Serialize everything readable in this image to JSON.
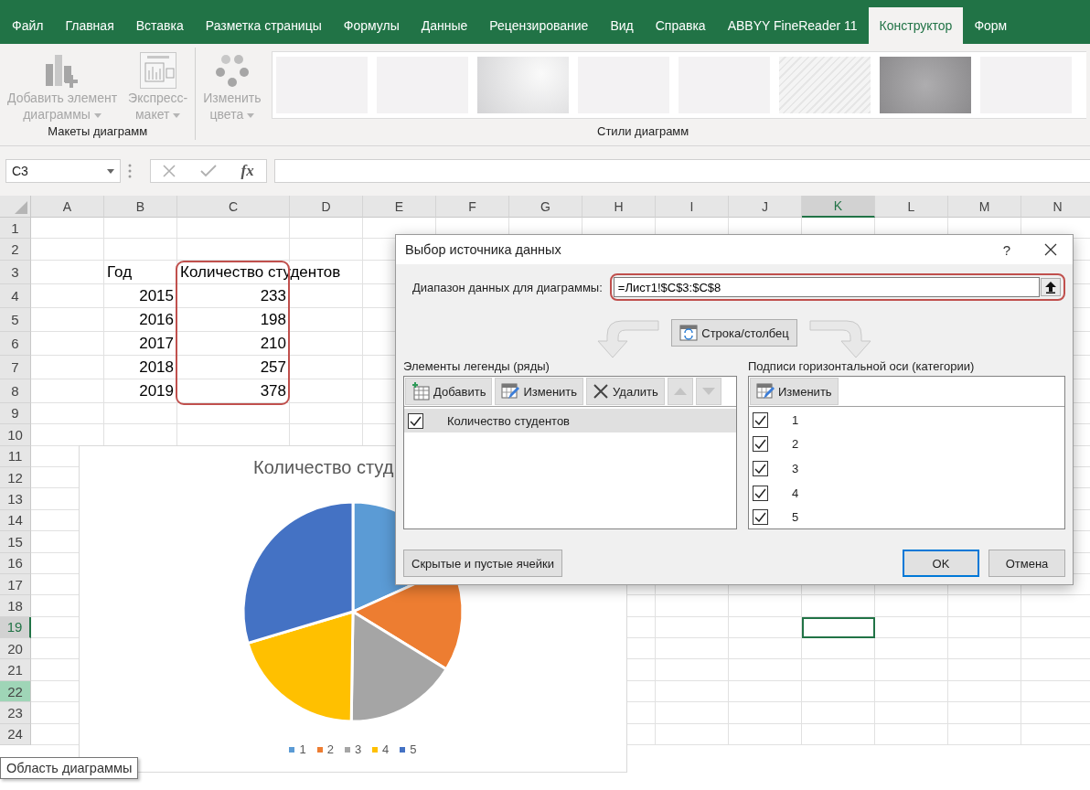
{
  "ribbon_tabs": [
    {
      "label": "Файл",
      "selected": false
    },
    {
      "label": "Главная",
      "selected": false
    },
    {
      "label": "Вставка",
      "selected": false
    },
    {
      "label": "Разметка страницы",
      "selected": false
    },
    {
      "label": "Формулы",
      "selected": false
    },
    {
      "label": "Данные",
      "selected": false
    },
    {
      "label": "Рецензирование",
      "selected": false
    },
    {
      "label": "Вид",
      "selected": false
    },
    {
      "label": "Справка",
      "selected": false
    },
    {
      "label": "ABBYY FineReader 11",
      "selected": false
    },
    {
      "label": "Конструктор",
      "selected": true
    },
    {
      "label": "Форм",
      "selected": false
    }
  ],
  "ribbon_groups": [
    {
      "label": "Макеты диаграмм",
      "buttons": [
        {
          "label": "Добавить элемент\nдиаграммы",
          "kind": "add-element",
          "disabled": true
        },
        {
          "label": "Экспресс-\nмакет",
          "kind": "quick-layout",
          "disabled": true
        }
      ]
    },
    {
      "label": "Стили диаграмм",
      "buttons": [
        {
          "label": "Изменить\nцвета",
          "kind": "colors",
          "disabled": true
        }
      ],
      "styles": [
        {
          "kind": "plain"
        },
        {
          "kind": "plain"
        },
        {
          "kind": "gradient"
        },
        {
          "kind": "plain"
        },
        {
          "kind": "plain"
        },
        {
          "kind": "hatched"
        },
        {
          "kind": "dark"
        },
        {
          "kind": "plain"
        }
      ]
    }
  ],
  "formula_bar": {
    "name_box": "C3",
    "function_label": "fx"
  },
  "sheet": {
    "columns": [
      {
        "label": "A",
        "selected": false
      },
      {
        "label": "B",
        "selected": false
      },
      {
        "label": "C",
        "selected": false
      },
      {
        "label": "D",
        "selected": false
      },
      {
        "label": "E",
        "selected": false
      },
      {
        "label": "F",
        "selected": false
      },
      {
        "label": "G",
        "selected": false
      },
      {
        "label": "H",
        "selected": false
      },
      {
        "label": "I",
        "selected": false
      },
      {
        "label": "J",
        "selected": false
      },
      {
        "label": "K",
        "selected": true
      },
      {
        "label": "L",
        "selected": false
      },
      {
        "label": "M",
        "selected": false
      },
      {
        "label": "N",
        "selected": false
      }
    ],
    "rows": [
      {
        "label": "1",
        "selected": false,
        "highlighted": false
      },
      {
        "label": "2",
        "selected": false,
        "highlighted": false
      },
      {
        "label": "3",
        "selected": false,
        "highlighted": false
      },
      {
        "label": "4",
        "selected": false,
        "highlighted": false
      },
      {
        "label": "5",
        "selected": false,
        "highlighted": false
      },
      {
        "label": "6",
        "selected": false,
        "highlighted": false
      },
      {
        "label": "7",
        "selected": false,
        "highlighted": false
      },
      {
        "label": "8",
        "selected": false,
        "highlighted": false
      },
      {
        "label": "9",
        "selected": false,
        "highlighted": false
      },
      {
        "label": "10",
        "selected": false,
        "highlighted": false
      },
      {
        "label": "11",
        "selected": false,
        "highlighted": false
      },
      {
        "label": "12",
        "selected": false,
        "highlighted": false
      },
      {
        "label": "13",
        "selected": false,
        "highlighted": false
      },
      {
        "label": "14",
        "selected": false,
        "highlighted": false
      },
      {
        "label": "15",
        "selected": false,
        "highlighted": false
      },
      {
        "label": "16",
        "selected": false,
        "highlighted": false
      },
      {
        "label": "17",
        "selected": false,
        "highlighted": false
      },
      {
        "label": "18",
        "selected": false,
        "highlighted": false
      },
      {
        "label": "19",
        "selected": true,
        "highlighted": false
      },
      {
        "label": "20",
        "selected": false,
        "highlighted": false
      },
      {
        "label": "21",
        "selected": false,
        "highlighted": false
      },
      {
        "label": "22",
        "selected": false,
        "highlighted": true
      },
      {
        "label": "23",
        "selected": false,
        "highlighted": false
      },
      {
        "label": "24",
        "selected": false,
        "highlighted": false
      }
    ],
    "data_table": {
      "header": [
        "Год",
        "Количество студентов"
      ],
      "rows": [
        [
          "2015",
          "233"
        ],
        [
          "2016",
          "198"
        ],
        [
          "2017",
          "210"
        ],
        [
          "2018",
          "257"
        ],
        [
          "2019",
          "378"
        ]
      ]
    }
  },
  "chart": {
    "title": "Количество студ",
    "legend": [
      {
        "color": "#5b9bd5"
      },
      {
        "color": "#ed7d31"
      },
      {
        "color": "#a5a5a5"
      },
      {
        "color": "#ffc000"
      },
      {
        "color": "#4472c4"
      }
    ],
    "chart_data": {
      "type": "pie",
      "categories": [
        "1",
        "2",
        "3",
        "4",
        "5"
      ],
      "values": [
        18.26,
        15.52,
        16.46,
        20.14,
        29.62
      ]
    }
  },
  "tooltip": "Область диаграммы",
  "dialog": {
    "title": "Выбор источника данных",
    "help": "?",
    "range_label": "Диапазон данных для диаграммы:",
    "range_value": "=Лист1!$C$3:$C$8",
    "switch_button": "Строка/столбец",
    "legend_panel": {
      "label": "Элементы легенды (ряды)",
      "buttons": [
        {
          "label": "Добавить",
          "kind": "add",
          "disabled": false
        },
        {
          "label": "Изменить",
          "kind": "edit",
          "disabled": false
        },
        {
          "label": "Удалить",
          "kind": "delete",
          "disabled": false
        },
        {
          "kind": "up",
          "disabled": true
        },
        {
          "kind": "down",
          "disabled": true
        }
      ],
      "items": [
        {
          "label": "Количество студентов",
          "checked": true,
          "selected": true
        }
      ]
    },
    "axis_panel": {
      "label": "Подписи горизонтальной оси (категории)",
      "buttons": [
        {
          "label": "Изменить",
          "kind": "edit",
          "disabled": false
        }
      ],
      "items": [
        {
          "label": "1",
          "checked": true,
          "selected": false
        },
        {
          "label": "2",
          "checked": true,
          "selected": false
        },
        {
          "label": "3",
          "checked": true,
          "selected": false
        },
        {
          "label": "4",
          "checked": true,
          "selected": false
        },
        {
          "label": "5",
          "checked": true,
          "selected": false
        }
      ]
    },
    "hidden_cells_button": "Скрытые и пустые ячейки",
    "ok_button": "OK",
    "cancel_button": "Отмена"
  }
}
